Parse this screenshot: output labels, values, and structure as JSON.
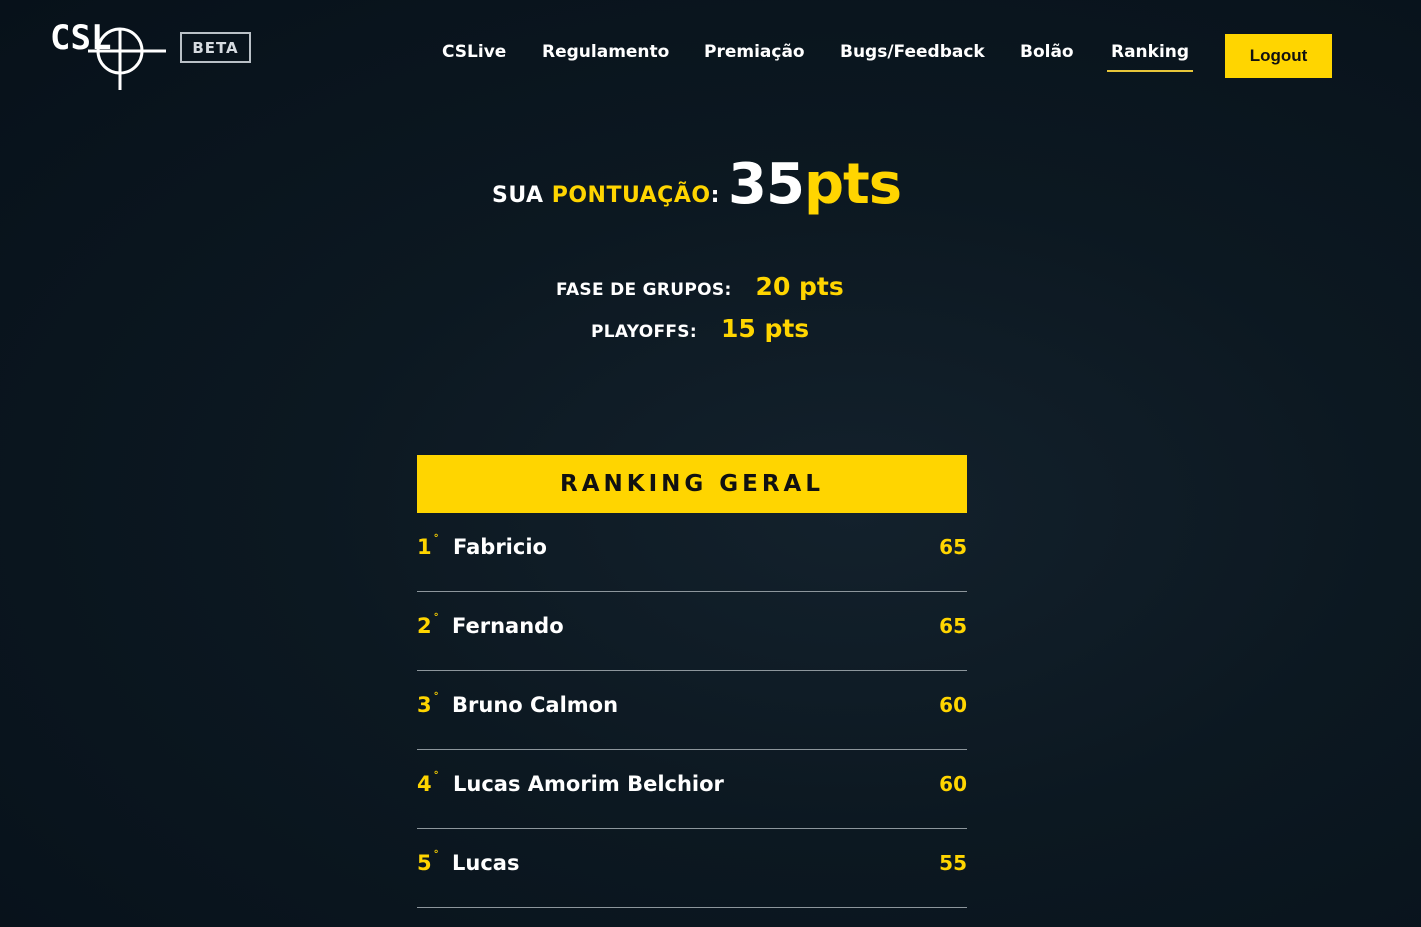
{
  "header": {
    "logo_text": "CSL",
    "beta_label": "BETA",
    "nav": [
      {
        "label": "CSLive"
      },
      {
        "label": "Regulamento"
      },
      {
        "label": "Premiação"
      },
      {
        "label": "Bugs/Feedback"
      },
      {
        "label": "Bolão"
      },
      {
        "label": "Ranking",
        "active": true
      }
    ],
    "logout_label": "Logout"
  },
  "score": {
    "prefix": "SUA ",
    "highlight": "PONTUAÇÃO",
    "suffix": ":",
    "value": "35",
    "unit": "pts"
  },
  "breakdown": [
    {
      "label": "FASE DE GRUPOS:",
      "value": "20 pts"
    },
    {
      "label": "PLAYOFFS:",
      "value": "15 pts"
    }
  ],
  "ranking": {
    "title": "RANKING GERAL",
    "rows": [
      {
        "position": "1",
        "ordinal": "°",
        "name": "Fabricio",
        "points": "65"
      },
      {
        "position": "2",
        "ordinal": "°",
        "name": "Fernando",
        "points": "65"
      },
      {
        "position": "3",
        "ordinal": "°",
        "name": "Bruno Calmon",
        "points": "60"
      },
      {
        "position": "4",
        "ordinal": "°",
        "name": "Lucas Amorim Belchior",
        "points": "60"
      },
      {
        "position": "5",
        "ordinal": "°",
        "name": "Lucas",
        "points": "55"
      }
    ]
  },
  "colors": {
    "accent": "#ffd500",
    "background": "#0c1821",
    "divider": "#8d969c"
  },
  "icons": [
    "csl-crosshair-logo-icon"
  ]
}
